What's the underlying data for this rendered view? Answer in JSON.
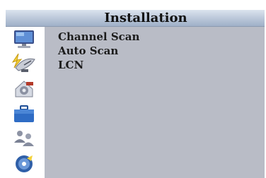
{
  "header": {
    "title": "Installation"
  },
  "sidebar": {
    "items": [
      {
        "icon": "tv-monitor-icon",
        "selected": false
      },
      {
        "icon": "satellite-dish-icon",
        "selected": true
      },
      {
        "icon": "settings-gear-icon",
        "selected": false
      },
      {
        "icon": "toolbox-icon",
        "selected": false
      },
      {
        "icon": "users-icon",
        "selected": false
      },
      {
        "icon": "media-disc-icon",
        "selected": false
      }
    ]
  },
  "menu": {
    "items": [
      {
        "label": "Channel Scan"
      },
      {
        "label": "Auto Scan"
      },
      {
        "label": "LCN"
      }
    ]
  },
  "colors": {
    "panel_background": "#b9bcc6",
    "title_bar": "#b9c6d8",
    "sidebar_background": "#ffffff",
    "text": "#1c1c1c"
  }
}
